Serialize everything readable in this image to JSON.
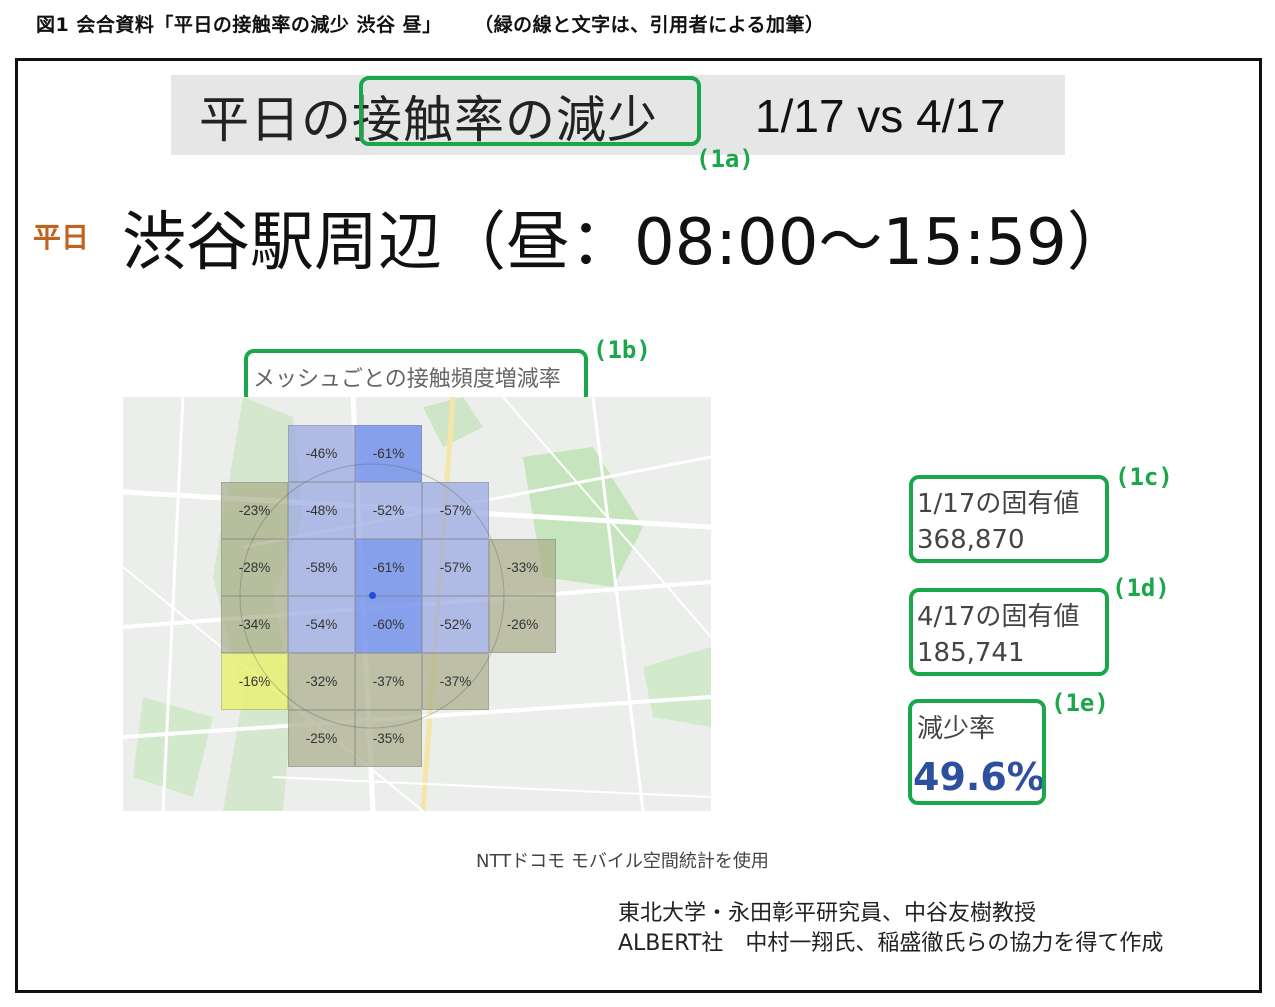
{
  "caption": {
    "figure": "図1 会合資料「平日の接触率の減少 渋谷 昼」",
    "note": "（緑の線と文字は、引用者による加筆）"
  },
  "slide": {
    "title_highlight_prefix": "平日の",
    "title_highlight": "接触率の減少",
    "title_compare": "1/17 vs 4/17",
    "weekday_tag": "平日",
    "subtitle": "渋谷駅周辺（昼：08:00〜15:59）",
    "map_caption": "メッシュごとの接触頻度増減率",
    "mesh_cells": [
      {
        "row": 0,
        "col": 2,
        "label": "-46%",
        "tone": "blue"
      },
      {
        "row": 0,
        "col": 3,
        "label": "-61%",
        "tone": "blue-deep"
      },
      {
        "row": 1,
        "col": 1,
        "label": "-23%",
        "tone": "khaki"
      },
      {
        "row": 1,
        "col": 2,
        "label": "-48%",
        "tone": "blue"
      },
      {
        "row": 1,
        "col": 3,
        "label": "-52%",
        "tone": "blue"
      },
      {
        "row": 1,
        "col": 4,
        "label": "-57%",
        "tone": "blue"
      },
      {
        "row": 2,
        "col": 1,
        "label": "-28%",
        "tone": "khaki"
      },
      {
        "row": 2,
        "col": 2,
        "label": "-58%",
        "tone": "blue"
      },
      {
        "row": 2,
        "col": 3,
        "label": "-61%",
        "tone": "blue-deep"
      },
      {
        "row": 2,
        "col": 4,
        "label": "-57%",
        "tone": "blue"
      },
      {
        "row": 2,
        "col": 5,
        "label": "-33%",
        "tone": "khaki"
      },
      {
        "row": 3,
        "col": 1,
        "label": "-34%",
        "tone": "khaki"
      },
      {
        "row": 3,
        "col": 2,
        "label": "-54%",
        "tone": "blue"
      },
      {
        "row": 3,
        "col": 3,
        "label": "-60%",
        "tone": "blue-deep"
      },
      {
        "row": 3,
        "col": 4,
        "label": "-52%",
        "tone": "blue"
      },
      {
        "row": 3,
        "col": 5,
        "label": "-26%",
        "tone": "khaki"
      },
      {
        "row": 4,
        "col": 1,
        "label": "-16%",
        "tone": "yellow"
      },
      {
        "row": 4,
        "col": 2,
        "label": "-32%",
        "tone": "khaki"
      },
      {
        "row": 4,
        "col": 3,
        "label": "-37%",
        "tone": "khaki"
      },
      {
        "row": 4,
        "col": 4,
        "label": "-37%",
        "tone": "khaki"
      },
      {
        "row": 5,
        "col": 2,
        "label": "-25%",
        "tone": "khaki"
      },
      {
        "row": 5,
        "col": 3,
        "label": "-35%",
        "tone": "khaki"
      }
    ],
    "stats": {
      "jan_label": "1/17の固有値",
      "jan_value": "368,870",
      "apr_label": "4/17の固有値",
      "apr_value": "185,741",
      "rate_label": "減少率",
      "rate_value": "49.6%"
    },
    "annotations": {
      "a": "(1a)",
      "b": "(1b)",
      "c": "(1c)",
      "d": "(1d)",
      "e": "(1e)"
    },
    "source": "NTTドコモ モバイル空間統計を使用",
    "credits": [
      "東北大学・永田彰平研究員、中谷友樹教授",
      "ALBERT社　中村一翔氏、稲盛徹氏らの協力を得て作成"
    ]
  },
  "colors": {
    "annotation_green": "#1aa64a",
    "weekday_orange": "#c0631f",
    "rate_blue": "#2e4f9e",
    "mesh_blue_deep": "#6e8ceb",
    "mesh_blue": "#96a5e1",
    "mesh_khaki": "#aaaf8c",
    "mesh_yellow": "#e8f078"
  }
}
